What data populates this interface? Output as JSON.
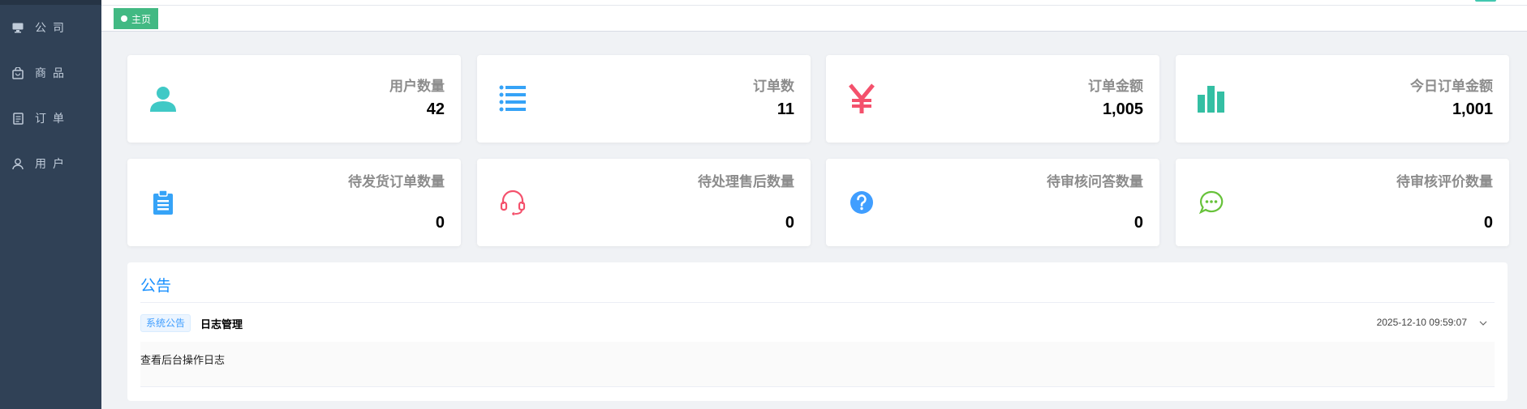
{
  "sidebar": {
    "bg_color": "#304156",
    "items": [
      {
        "label": "公司",
        "icon": "monitor-icon"
      },
      {
        "label": "商品",
        "icon": "shopping-bag-icon"
      },
      {
        "label": "订单",
        "icon": "document-icon"
      },
      {
        "label": "用户",
        "icon": "user-icon"
      }
    ]
  },
  "tags": {
    "active_label": "主页",
    "active_color": "#42b983"
  },
  "stats_row1": [
    {
      "label": "用户数量",
      "value": "42",
      "icon": "user-icon",
      "color": "#40c9c6"
    },
    {
      "label": "订单数",
      "value": "11",
      "icon": "list-icon",
      "color": "#36a3f7"
    },
    {
      "label": "订单金额",
      "value": "1,005",
      "icon": "yen-icon",
      "color": "#f4516c"
    },
    {
      "label": "今日订单金额",
      "value": "1,001",
      "icon": "bar-chart-icon",
      "color": "#34bfa3"
    }
  ],
  "stats_row2": [
    {
      "label": "待发货订单数量",
      "value": "0",
      "icon": "clipboard-icon",
      "color": "#36a3f7"
    },
    {
      "label": "待处理售后数量",
      "value": "0",
      "icon": "headset-icon",
      "color": "#f4516c"
    },
    {
      "label": "待审核问答数量",
      "value": "0",
      "icon": "question-icon",
      "color": "#409eff"
    },
    {
      "label": "待审核评价数量",
      "value": "0",
      "icon": "chat-icon",
      "color": "#67c23a"
    }
  ],
  "notice": {
    "title": "公告",
    "items": [
      {
        "badge": "系统公告",
        "title": "日志管理",
        "time": "2025-12-10 09:59:07",
        "body": "查看后台操作日志"
      }
    ]
  }
}
